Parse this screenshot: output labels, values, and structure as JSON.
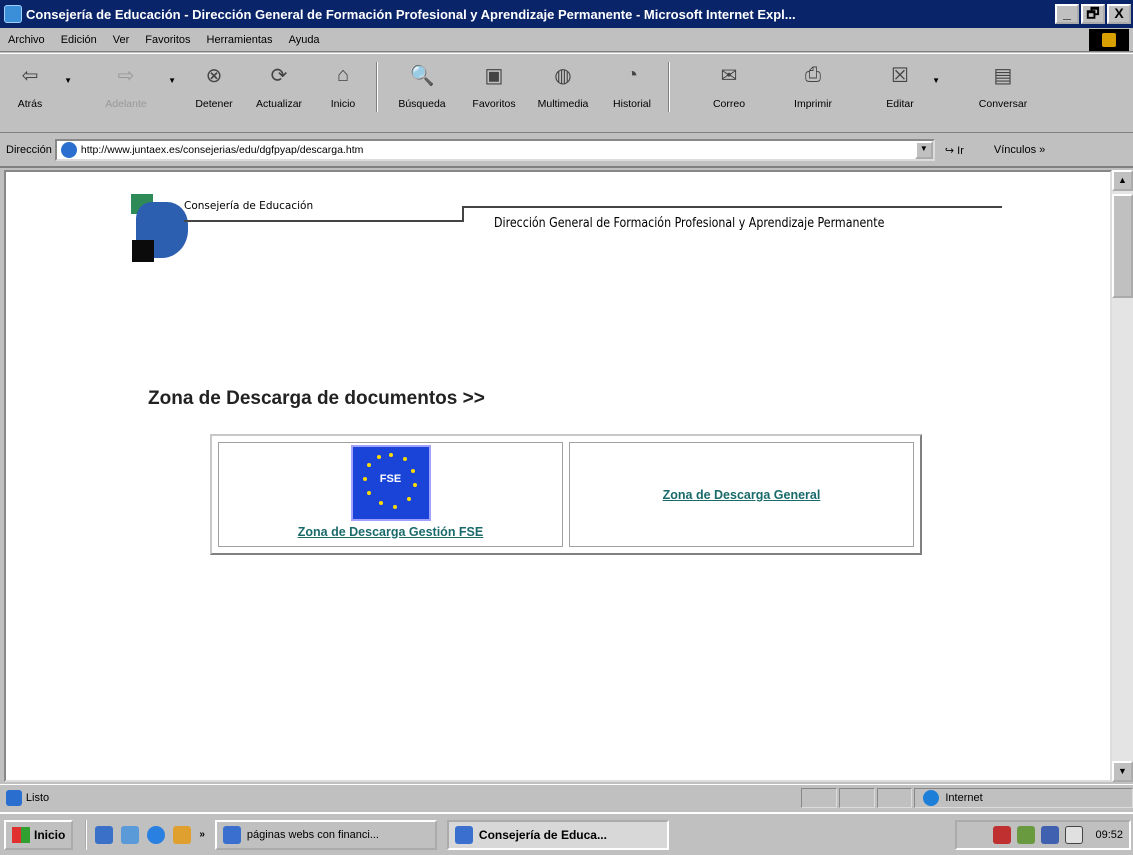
{
  "window": {
    "title": "Consejería de Educación - Dirección General de Formación Profesional y Aprendizaje Permanente - Microsoft Internet Expl...",
    "buttons": [
      "_",
      "🗗",
      "X"
    ]
  },
  "menu": {
    "items": [
      "Archivo",
      "Edición",
      "Ver",
      "Favoritos",
      "Herramientas",
      "Ayuda"
    ]
  },
  "toolbar": {
    "buttons": [
      {
        "label": "Atrás",
        "icon": "back-arrow-icon"
      },
      {
        "label": "Adelante",
        "icon": "forward-arrow-icon"
      },
      {
        "label": "Detener",
        "icon": "stop-icon"
      },
      {
        "label": "Actualizar",
        "icon": "refresh-icon"
      },
      {
        "label": "Inicio",
        "icon": "home-icon"
      },
      {
        "label": "Búsqueda",
        "icon": "search-icon"
      },
      {
        "label": "Favoritos",
        "icon": "favorites-icon"
      },
      {
        "label": "Multimedia",
        "icon": "media-icon"
      },
      {
        "label": "Historial",
        "icon": "history-icon"
      },
      {
        "label": "Correo",
        "icon": "mail-icon"
      },
      {
        "label": "Imprimir",
        "icon": "print-icon"
      },
      {
        "label": "Editar",
        "icon": "edit-icon"
      },
      {
        "label": "Conversar",
        "icon": "discuss-icon"
      }
    ]
  },
  "address": {
    "label": "Dirección",
    "url": "http://www.juntaex.es/consejerias/edu/dgfpyap/descarga.htm",
    "go": "Ir",
    "links": "Vínculos »"
  },
  "page": {
    "logo_text": "Consejería de Educación",
    "header_title": "Dirección General de Formación Profesional y Aprendizaje Permanente",
    "zone_title": "Zona de Descarga de documentos >>",
    "fse_badge": "FSE",
    "link_fse": "Zona de Descarga Gestión FSE",
    "link_general": "Zona de Descarga General"
  },
  "status": {
    "text": "Listo",
    "zone": "Internet"
  },
  "taskbar": {
    "start": "Inicio",
    "tasks": [
      {
        "label": "páginas webs con financi...",
        "active": false
      },
      {
        "label": "Consejería de Educa...",
        "active": true
      }
    ],
    "clock": "09:52",
    "more": "»"
  },
  "colors": {
    "titlebar": "#0a246a",
    "link": "#1a6a6a",
    "fse_blue": "#1a44d8"
  }
}
